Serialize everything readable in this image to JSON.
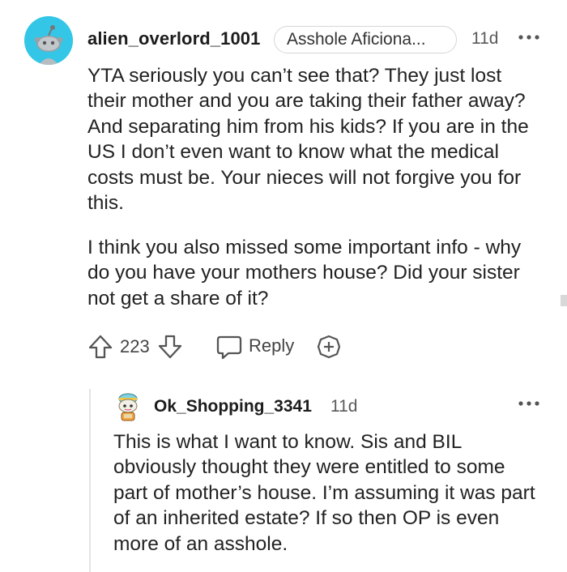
{
  "comment": {
    "username": "alien_overlord_1001",
    "flair": "Asshole Aficiona...",
    "timestamp": "11d",
    "avatar_icon": "reddit-alien-avatar-icon",
    "paragraphs": [
      "YTA seriously you can’t see that? They just lost their mother and you are taking their father away? And separating him from his kids? If you are in the US I don’t even want to know what the medical costs must be. Your nieces will not forgive you for this.",
      "I think you also missed some important info - why do you have your mothers house? Did your sister not get a share of it?"
    ],
    "actions": {
      "score": "223",
      "reply_label": "Reply"
    }
  },
  "reply": {
    "username": "Ok_Shopping_3341",
    "timestamp": "11d",
    "avatar_icon": "snoo-with-cap-avatar-icon",
    "text": "This is what I want to know. Sis and BIL obviously thought they were entitled to some part of mother’s house. I’m assuming it was part of an inherited estate? If so then OP is even more of an asshole."
  },
  "colors": {
    "avatar_bg": "#34c6e6",
    "text": "#222222",
    "muted": "#5a5a5a",
    "icon": "#555555"
  }
}
